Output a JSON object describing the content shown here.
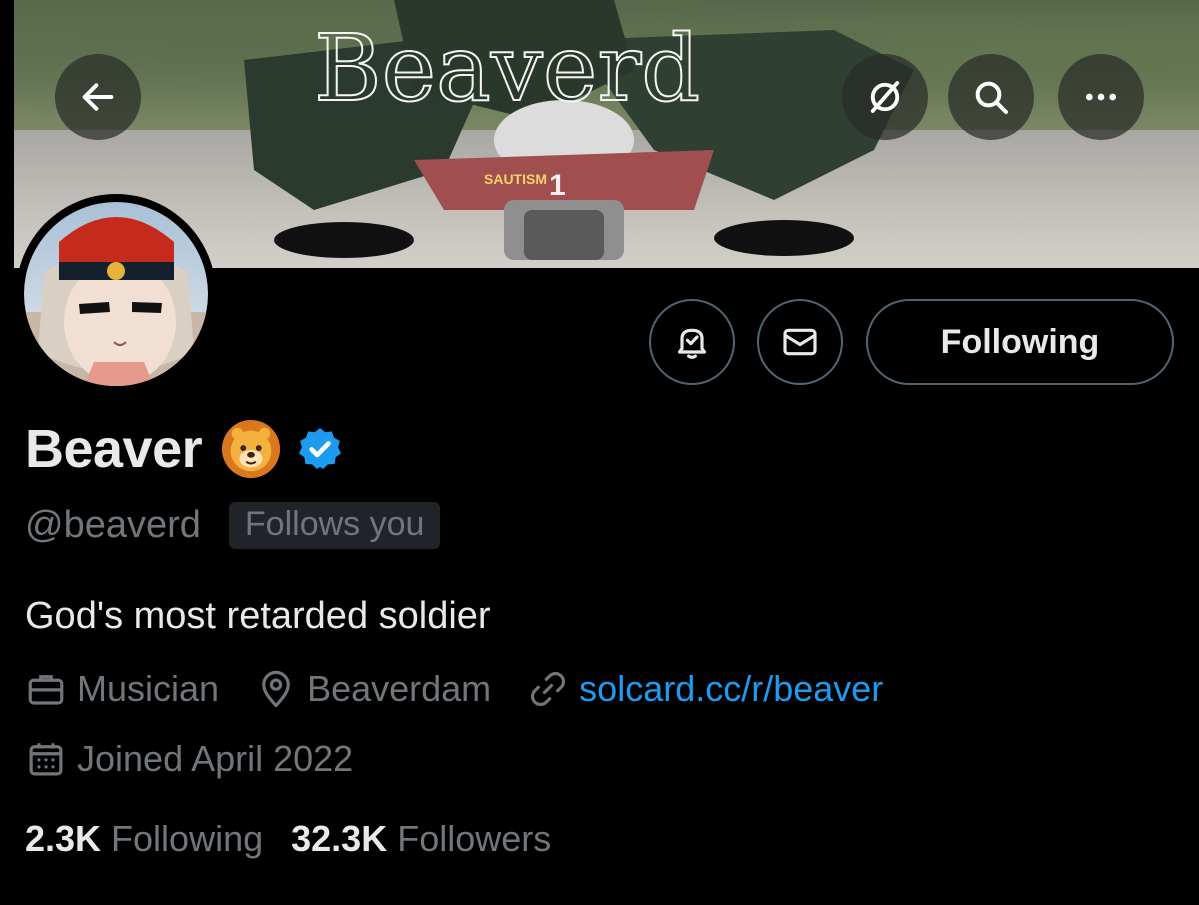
{
  "header": {
    "banner_overlay_text": "Beaverd",
    "banner_jersey_text": "SAUTISM",
    "banner_jersey_number": "1"
  },
  "actions": {
    "following_label": "Following"
  },
  "profile": {
    "display_name": "Beaver",
    "emoji": "lion-face",
    "verified": true,
    "handle": "@beaverd",
    "follows_you_label": "Follows you",
    "bio": "God's most retarded soldier",
    "profession": "Musician",
    "location": "Beaverdam",
    "website": "solcard.cc/r/beaver",
    "joined": "Joined April 2022"
  },
  "stats": {
    "following_count": "2.3K",
    "following_label": "Following",
    "followers_count": "32.3K",
    "followers_label": "Followers"
  },
  "icons": {
    "back": "arrow-left-icon",
    "grok": "grok-icon",
    "search": "search-icon",
    "more": "more-horizontal-icon",
    "notifications": "bell-check-icon",
    "message": "envelope-icon",
    "profession": "briefcase-icon",
    "location": "map-pin-icon",
    "link": "link-icon",
    "calendar": "calendar-icon",
    "verified": "verified-badge-icon"
  },
  "colors": {
    "background": "#000000",
    "text_primary": "#e7e9ea",
    "text_secondary": "#71767b",
    "link": "#1d9bf0",
    "verified": "#1d9bf0",
    "border": "#536471"
  }
}
